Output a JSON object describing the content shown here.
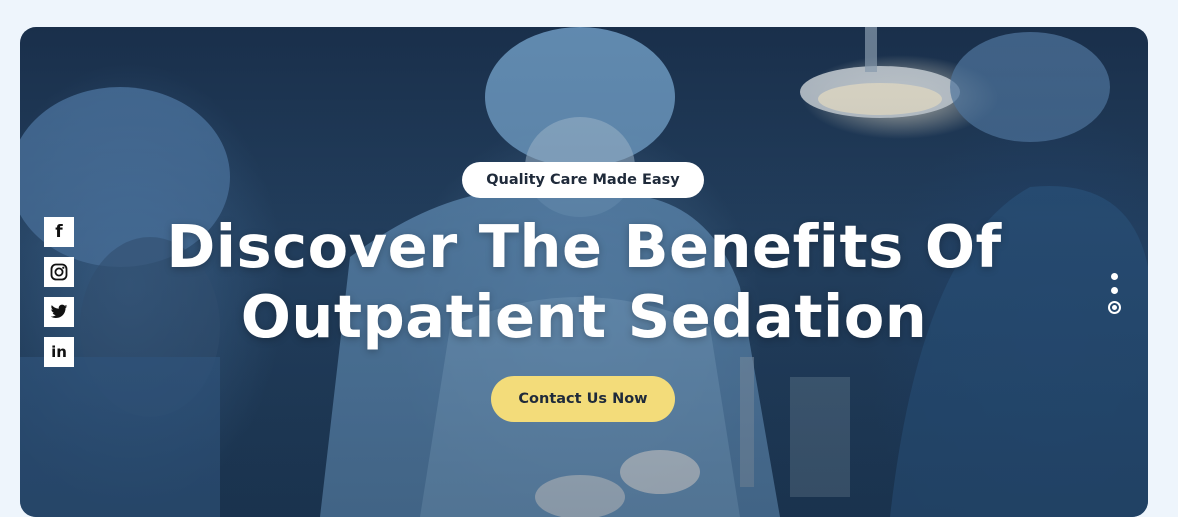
{
  "hero": {
    "tag": "Quality Care Made Easy",
    "headline_line1": "Discover The Benefits Of",
    "headline_line2": "Outpatient Sedation",
    "cta_label": "Contact Us Now",
    "background_image": "surgeons-operating-room-photo"
  },
  "social": [
    {
      "name": "facebook-icon",
      "glyph": "f"
    },
    {
      "name": "instagram-icon"
    },
    {
      "name": "twitter-icon"
    },
    {
      "name": "linkedin-icon",
      "glyph": "in"
    }
  ],
  "slider": {
    "count": 3,
    "active_index": 3
  },
  "colors": {
    "page_bg": "#eef5fc",
    "tag_bg": "#ffffff",
    "cta_bg": "#f3dc7a",
    "text_dark": "#1f2a3a",
    "headline": "#ffffff"
  }
}
